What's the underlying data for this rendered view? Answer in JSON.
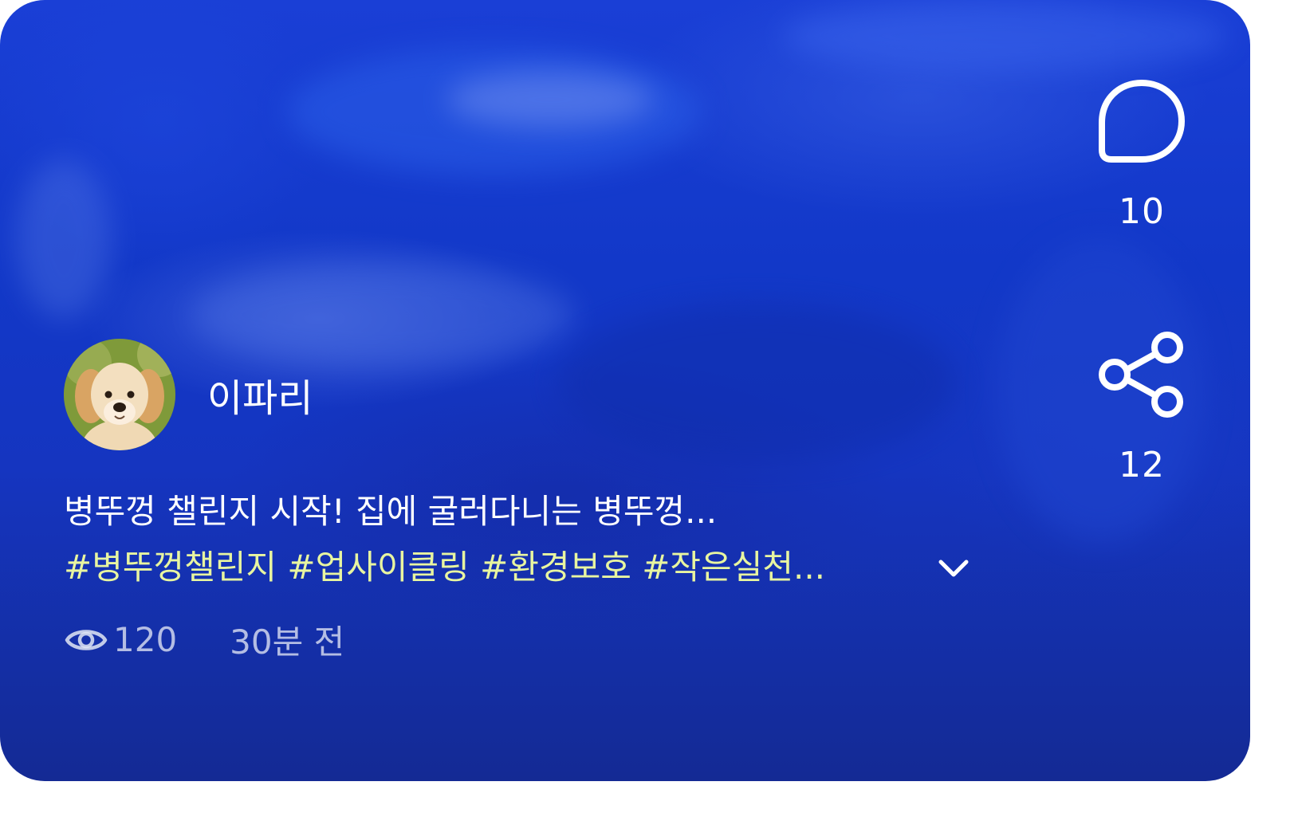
{
  "post": {
    "author_name": "이파리",
    "caption": "병뚜껑 챌린지 시작!  집에 굴러다니는 병뚜껑...",
    "hashtags": "#병뚜껑챌린지 #업사이클링 #환경보호 #작은실천...",
    "views": "120",
    "time_ago": "30분 전"
  },
  "actions": {
    "comments": {
      "icon": "comment-bubble-icon",
      "count": "10"
    },
    "share": {
      "icon": "share-icon",
      "count": "12"
    }
  },
  "colors": {
    "background": "#1238c8",
    "text": "#ffffff",
    "hashtag": "#e8f5a0",
    "meta": "#c8cdea"
  }
}
